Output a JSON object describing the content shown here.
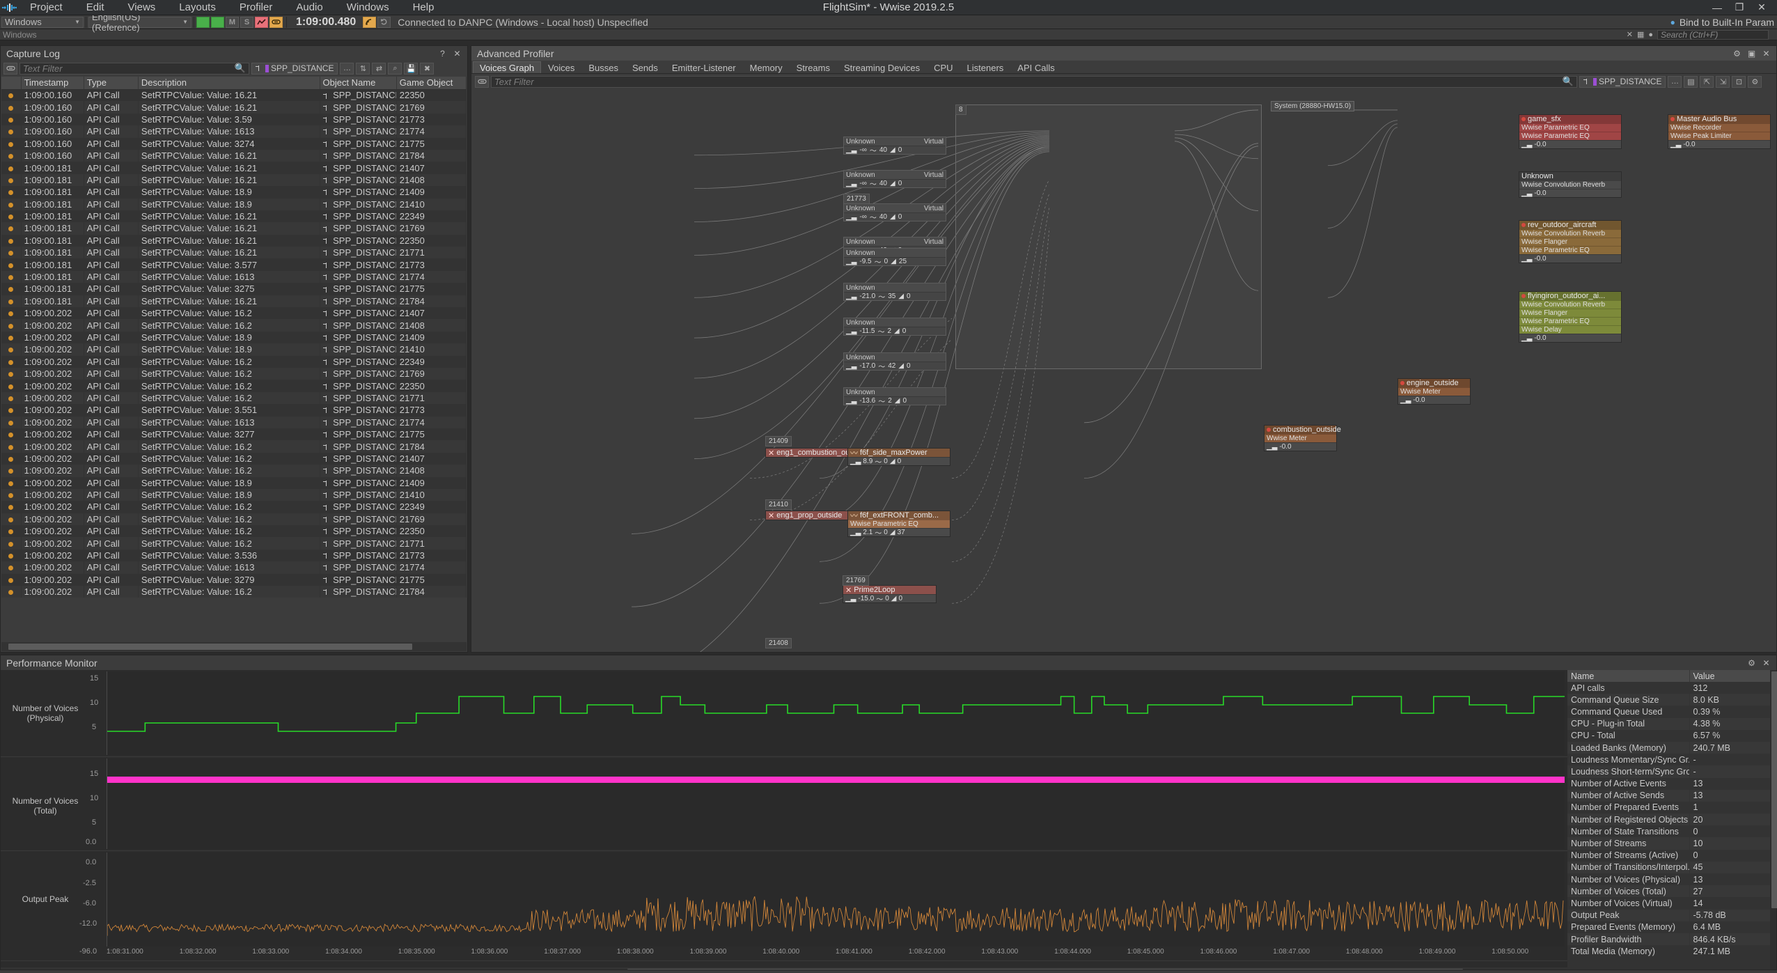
{
  "window": {
    "title": "FlightSim* - Wwise 2019.2.5",
    "minimize": "—",
    "maximize": "❐",
    "close": "✕"
  },
  "menu": [
    "Project",
    "Edit",
    "Views",
    "Layouts",
    "Profiler",
    "Audio",
    "Windows",
    "Help"
  ],
  "toolbar": {
    "platform_selector": "Windows",
    "language_selector": "English(US) (Reference)",
    "mute_label": "M",
    "solo_label": "S",
    "timecode": "1:09:00.480",
    "connection_status": "Connected to DANPC (Windows - Local host) Unspecified",
    "bind_to_param": "Bind to Built-In Param",
    "search_placeholder": "Search (Ctrl+F)"
  },
  "bar2": {
    "windows_label": "Windows"
  },
  "capture_log": {
    "title": "Capture Log",
    "filter_placeholder": "Text Filter",
    "game_object_tag": "SPP_DISTANCE",
    "columns": [
      "",
      "Timestamp",
      "Type",
      "Description",
      "Object Name",
      "Game Object"
    ],
    "rows": [
      [
        "1:09:00.160",
        "API Call",
        "SetRTPCValue: Value: 16.21",
        "SPP_DISTANCE",
        "22350"
      ],
      [
        "1:09:00.160",
        "API Call",
        "SetRTPCValue: Value: 16.21",
        "SPP_DISTANCE",
        "21769"
      ],
      [
        "1:09:00.160",
        "API Call",
        "SetRTPCValue: Value: 3.59",
        "SPP_DISTANCE",
        "21773"
      ],
      [
        "1:09:00.160",
        "API Call",
        "SetRTPCValue: Value: 1613",
        "SPP_DISTANCE",
        "21774"
      ],
      [
        "1:09:00.160",
        "API Call",
        "SetRTPCValue: Value: 3274",
        "SPP_DISTANCE",
        "21775"
      ],
      [
        "1:09:00.160",
        "API Call",
        "SetRTPCValue: Value: 16.21",
        "SPP_DISTANCE",
        "21784"
      ],
      [
        "1:09:00.181",
        "API Call",
        "SetRTPCValue: Value: 16.21",
        "SPP_DISTANCE",
        "21407"
      ],
      [
        "1:09:00.181",
        "API Call",
        "SetRTPCValue: Value: 16.21",
        "SPP_DISTANCE",
        "21408"
      ],
      [
        "1:09:00.181",
        "API Call",
        "SetRTPCValue: Value: 18.9",
        "SPP_DISTANCE",
        "21409"
      ],
      [
        "1:09:00.181",
        "API Call",
        "SetRTPCValue: Value: 18.9",
        "SPP_DISTANCE",
        "21410"
      ],
      [
        "1:09:00.181",
        "API Call",
        "SetRTPCValue: Value: 16.21",
        "SPP_DISTANCE",
        "22349"
      ],
      [
        "1:09:00.181",
        "API Call",
        "SetRTPCValue: Value: 16.21",
        "SPP_DISTANCE",
        "21769"
      ],
      [
        "1:09:00.181",
        "API Call",
        "SetRTPCValue: Value: 16.21",
        "SPP_DISTANCE",
        "22350"
      ],
      [
        "1:09:00.181",
        "API Call",
        "SetRTPCValue: Value: 16.21",
        "SPP_DISTANCE",
        "21771"
      ],
      [
        "1:09:00.181",
        "API Call",
        "SetRTPCValue: Value: 3.577",
        "SPP_DISTANCE",
        "21773"
      ],
      [
        "1:09:00.181",
        "API Call",
        "SetRTPCValue: Value: 1613",
        "SPP_DISTANCE",
        "21774"
      ],
      [
        "1:09:00.181",
        "API Call",
        "SetRTPCValue: Value: 3275",
        "SPP_DISTANCE",
        "21775"
      ],
      [
        "1:09:00.181",
        "API Call",
        "SetRTPCValue: Value: 16.21",
        "SPP_DISTANCE",
        "21784"
      ],
      [
        "1:09:00.202",
        "API Call",
        "SetRTPCValue: Value: 16.2",
        "SPP_DISTANCE",
        "21407"
      ],
      [
        "1:09:00.202",
        "API Call",
        "SetRTPCValue: Value: 16.2",
        "SPP_DISTANCE",
        "21408"
      ],
      [
        "1:09:00.202",
        "API Call",
        "SetRTPCValue: Value: 18.9",
        "SPP_DISTANCE",
        "21409"
      ],
      [
        "1:09:00.202",
        "API Call",
        "SetRTPCValue: Value: 18.9",
        "SPP_DISTANCE",
        "21410"
      ],
      [
        "1:09:00.202",
        "API Call",
        "SetRTPCValue: Value: 16.2",
        "SPP_DISTANCE",
        "22349"
      ],
      [
        "1:09:00.202",
        "API Call",
        "SetRTPCValue: Value: 16.2",
        "SPP_DISTANCE",
        "21769"
      ],
      [
        "1:09:00.202",
        "API Call",
        "SetRTPCValue: Value: 16.2",
        "SPP_DISTANCE",
        "22350"
      ],
      [
        "1:09:00.202",
        "API Call",
        "SetRTPCValue: Value: 16.2",
        "SPP_DISTANCE",
        "21771"
      ],
      [
        "1:09:00.202",
        "API Call",
        "SetRTPCValue: Value: 3.551",
        "SPP_DISTANCE",
        "21773"
      ],
      [
        "1:09:00.202",
        "API Call",
        "SetRTPCValue: Value: 1613",
        "SPP_DISTANCE",
        "21774"
      ],
      [
        "1:09:00.202",
        "API Call",
        "SetRTPCValue: Value: 3277",
        "SPP_DISTANCE",
        "21775"
      ],
      [
        "1:09:00.202",
        "API Call",
        "SetRTPCValue: Value: 16.2",
        "SPP_DISTANCE",
        "21784"
      ],
      [
        "1:09:00.202",
        "API Call",
        "SetRTPCValue: Value: 16.2",
        "SPP_DISTANCE",
        "21407"
      ],
      [
        "1:09:00.202",
        "API Call",
        "SetRTPCValue: Value: 16.2",
        "SPP_DISTANCE",
        "21408"
      ],
      [
        "1:09:00.202",
        "API Call",
        "SetRTPCValue: Value: 18.9",
        "SPP_DISTANCE",
        "21409"
      ],
      [
        "1:09:00.202",
        "API Call",
        "SetRTPCValue: Value: 18.9",
        "SPP_DISTANCE",
        "21410"
      ],
      [
        "1:09:00.202",
        "API Call",
        "SetRTPCValue: Value: 16.2",
        "SPP_DISTANCE",
        "22349"
      ],
      [
        "1:09:00.202",
        "API Call",
        "SetRTPCValue: Value: 16.2",
        "SPP_DISTANCE",
        "21769"
      ],
      [
        "1:09:00.202",
        "API Call",
        "SetRTPCValue: Value: 16.2",
        "SPP_DISTANCE",
        "22350"
      ],
      [
        "1:09:00.202",
        "API Call",
        "SetRTPCValue: Value: 16.2",
        "SPP_DISTANCE",
        "21771"
      ],
      [
        "1:09:00.202",
        "API Call",
        "SetRTPCValue: Value: 3.536",
        "SPP_DISTANCE",
        "21773"
      ],
      [
        "1:09:00.202",
        "API Call",
        "SetRTPCValue: Value: 1613",
        "SPP_DISTANCE",
        "21774"
      ],
      [
        "1:09:00.202",
        "API Call",
        "SetRTPCValue: Value: 3279",
        "SPP_DISTANCE",
        "21775"
      ],
      [
        "1:09:00.202",
        "API Call",
        "SetRTPCValue: Value: 16.2",
        "SPP_DISTANCE",
        "21784"
      ]
    ]
  },
  "advanced_profiler": {
    "title": "Advanced Profiler",
    "tabs": [
      "Voices Graph",
      "Voices",
      "Busses",
      "Sends",
      "Emitter-Listener",
      "Memory",
      "Streams",
      "Streaming Devices",
      "CPU",
      "Listeners",
      "API Calls"
    ],
    "active_tab": "Voices Graph",
    "filter_placeholder": "Text Filter",
    "game_object_tag": "SPP_DISTANCE",
    "system_label": "System (28880-HW15.0)",
    "group_id": "8",
    "id_labels": [
      "21773",
      "21409",
      "21410",
      "21769",
      "21408"
    ],
    "virtual_voices": [
      {
        "name": "Unknown",
        "kind": "Virtual",
        "vol": "-∞",
        "pan": "40",
        "val": "0"
      },
      {
        "name": "Unknown",
        "kind": "Virtual",
        "vol": "-∞",
        "pan": "40",
        "val": "0"
      },
      {
        "name": "Unknown",
        "kind": "Virtual",
        "vol": "-∞",
        "pan": "40",
        "val": "0"
      },
      {
        "name": "Unknown",
        "kind": "Virtual",
        "vol": "-∞",
        "pan": "40",
        "val": "0"
      }
    ],
    "unknown_voices": [
      {
        "name": "Unknown",
        "vol": "-9.5",
        "a": "0",
        "b": "25"
      },
      {
        "name": "Unknown",
        "vol": "-21.0",
        "a": "35",
        "b": "0"
      },
      {
        "name": "Unknown",
        "vol": "-11.5",
        "a": "2",
        "b": "0"
      },
      {
        "name": "Unknown",
        "vol": "-17.0",
        "a": "42",
        "b": "0"
      },
      {
        "name": "Unknown",
        "vol": "-13.6",
        "a": "2",
        "b": "0"
      }
    ],
    "source_nodes": [
      {
        "id": "21409",
        "name": "eng1_combustion_ou...",
        "child": "f6f_side_maxPower",
        "vol": "8.9",
        "a": "0",
        "b": "0"
      },
      {
        "id": "21410",
        "name": "eng1_prop_outside",
        "child": "f6f_extFRONT_comb...",
        "effect": "Wwise Parametric EQ",
        "vol": "2.1",
        "a": "0",
        "b": "37"
      },
      {
        "id": "21769",
        "name": "Prime2Loop",
        "vol": "-15.0",
        "a": "0",
        "b": "0"
      }
    ],
    "bus_nodes": [
      {
        "name": "game_sfx",
        "color": "#a04545",
        "effects": [
          "Wwise Parametric EQ",
          "Wwise Parametric EQ"
        ],
        "meter": "-0.0"
      },
      {
        "name": "Unknown",
        "color": "#4a4a4a",
        "effects": [
          "Wwise Convolution Reverb"
        ],
        "meter": "-0.0"
      },
      {
        "name": "rev_outdoor_aircraft",
        "color": "#8a6a3a",
        "effects": [
          "Wwise Convolution Reverb",
          "Wwise Flanger",
          "Wwise Parametric EQ"
        ],
        "meter": "-0.0"
      },
      {
        "name": "flyingiron_outdoor_ai...",
        "color": "#7d8a3a",
        "effects": [
          "Wwise Convolution Reverb",
          "Wwise Flanger",
          "Wwise Parametric EQ",
          "Wwise Delay"
        ],
        "meter": "-0.0"
      },
      {
        "name": "Master Audio Bus",
        "color": "#8a5a3a",
        "effects": [
          "Wwise Recorder",
          "Wwise Peak Limiter"
        ],
        "meter": "-0.0"
      }
    ],
    "meter_nodes": [
      {
        "name": "engine_outside",
        "effect": "Wwise Meter",
        "meter": "-0.0"
      },
      {
        "name": "combustion_outside",
        "effect": "Wwise Meter",
        "meter": "-0.0"
      }
    ]
  },
  "performance_monitor": {
    "title": "Performance Monitor",
    "charts": [
      {
        "label": "Number of Voices (Physical)",
        "yticks": [
          "15",
          "10",
          "5"
        ],
        "color": "#28d928",
        "type": "step"
      },
      {
        "label": "Number of Voices (Total)",
        "yticks": [
          "15",
          "10",
          "5",
          "0.0"
        ],
        "color": "#ff33c9",
        "type": "flat"
      },
      {
        "label": "Output Peak",
        "yticks": [
          "0.0",
          "-2.5",
          "-6.0",
          "-12.0",
          "-96.0"
        ],
        "color": "#d98a3a",
        "type": "noise"
      }
    ],
    "xticks": [
      "1:08:31.000",
      "1:08:32.000",
      "1:08:33.000",
      "1:08:34.000",
      "1:08:35.000",
      "1:08:36.000",
      "1:08:37.000",
      "1:08:38.000",
      "1:08:39.000",
      "1:08:40.000",
      "1:08:41.000",
      "1:08:42.000",
      "1:08:43.000",
      "1:08:44.000",
      "1:08:45.000",
      "1:08:46.000",
      "1:08:47.000",
      "1:08:48.000",
      "1:08:49.000",
      "1:08:50.000"
    ],
    "table": {
      "columns": [
        "Name",
        "Value"
      ],
      "rows": [
        [
          "API calls",
          "312"
        ],
        [
          "Command Queue Size",
          "8.0 KB"
        ],
        [
          "Command Queue Used",
          "0.39 %"
        ],
        [
          "CPU - Plug-in Total",
          "4.38 %"
        ],
        [
          "CPU - Total",
          "6.57 %"
        ],
        [
          "Loaded Banks (Memory)",
          "240.7 MB"
        ],
        [
          "Loudness Momentary/Sync Gr...",
          "-"
        ],
        [
          "Loudness Short-term/Sync Gro...",
          "-"
        ],
        [
          "Number of Active Events",
          "13"
        ],
        [
          "Number of Active Sends",
          "13"
        ],
        [
          "Number of Prepared Events",
          "1"
        ],
        [
          "Number of Registered Objects",
          "20"
        ],
        [
          "Number of State Transitions",
          "0"
        ],
        [
          "Number of Streams",
          "10"
        ],
        [
          "Number of Streams (Active)",
          "0"
        ],
        [
          "Number of Transitions/Interpol...",
          "45"
        ],
        [
          "Number of Voices (Physical)",
          "13"
        ],
        [
          "Number of Voices (Total)",
          "27"
        ],
        [
          "Number of Voices (Virtual)",
          "14"
        ],
        [
          "Output Peak",
          "-5.78 dB"
        ],
        [
          "Prepared Events (Memory)",
          "6.4 MB"
        ],
        [
          "Profiler Bandwidth",
          "846.4 KB/s"
        ],
        [
          "Total Media (Memory)",
          "247.1 MB"
        ]
      ]
    }
  }
}
